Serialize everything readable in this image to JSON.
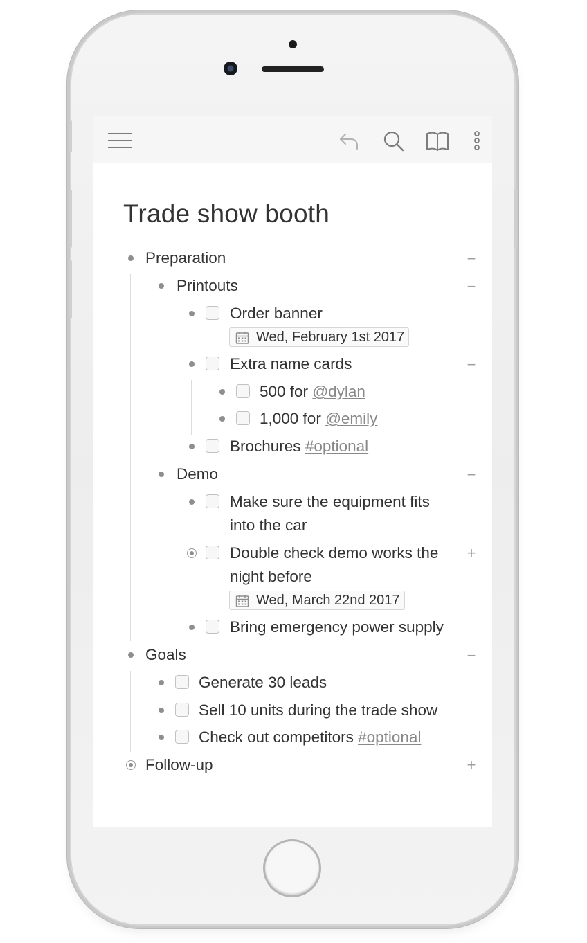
{
  "toolbar": {
    "menu_icon": "hamburger-menu-icon",
    "undo_icon": "undo-icon",
    "search_icon": "search-icon",
    "book_icon": "book-icon",
    "more_icon": "more-vertical-icon"
  },
  "document": {
    "title": "Trade show booth",
    "items": {
      "preparation": "Preparation",
      "printouts": "Printouts",
      "order_banner": "Order banner",
      "order_banner_date": "Wed, February 1st 2017",
      "extra_name_cards": "Extra name cards",
      "cards_500": "500 for ",
      "cards_500_mention": "@dylan",
      "cards_1000": "1,000 for ",
      "cards_1000_mention": "@emily",
      "brochures": "Brochures ",
      "brochures_tag": "#optional",
      "demo": "Demo",
      "equipment_line1": "Make sure the equipment fits",
      "equipment_line2": "into the car",
      "double_check_line1": "Double check demo works the",
      "double_check_line2": "night before",
      "double_check_date": "Wed, March 22nd 2017",
      "power_supply": "Bring emergency power supply",
      "goals": "Goals",
      "generate_leads": "Generate 30 leads",
      "sell_units": "Sell 10 units during the trade show",
      "competitors": "Check out competitors ",
      "competitors_tag": "#optional",
      "follow_up": "Follow-up"
    }
  },
  "colors": {
    "text": "#333333",
    "muted": "#8e8e8e",
    "tag": "#888888",
    "toolbar_bg": "#f6f6f6"
  }
}
